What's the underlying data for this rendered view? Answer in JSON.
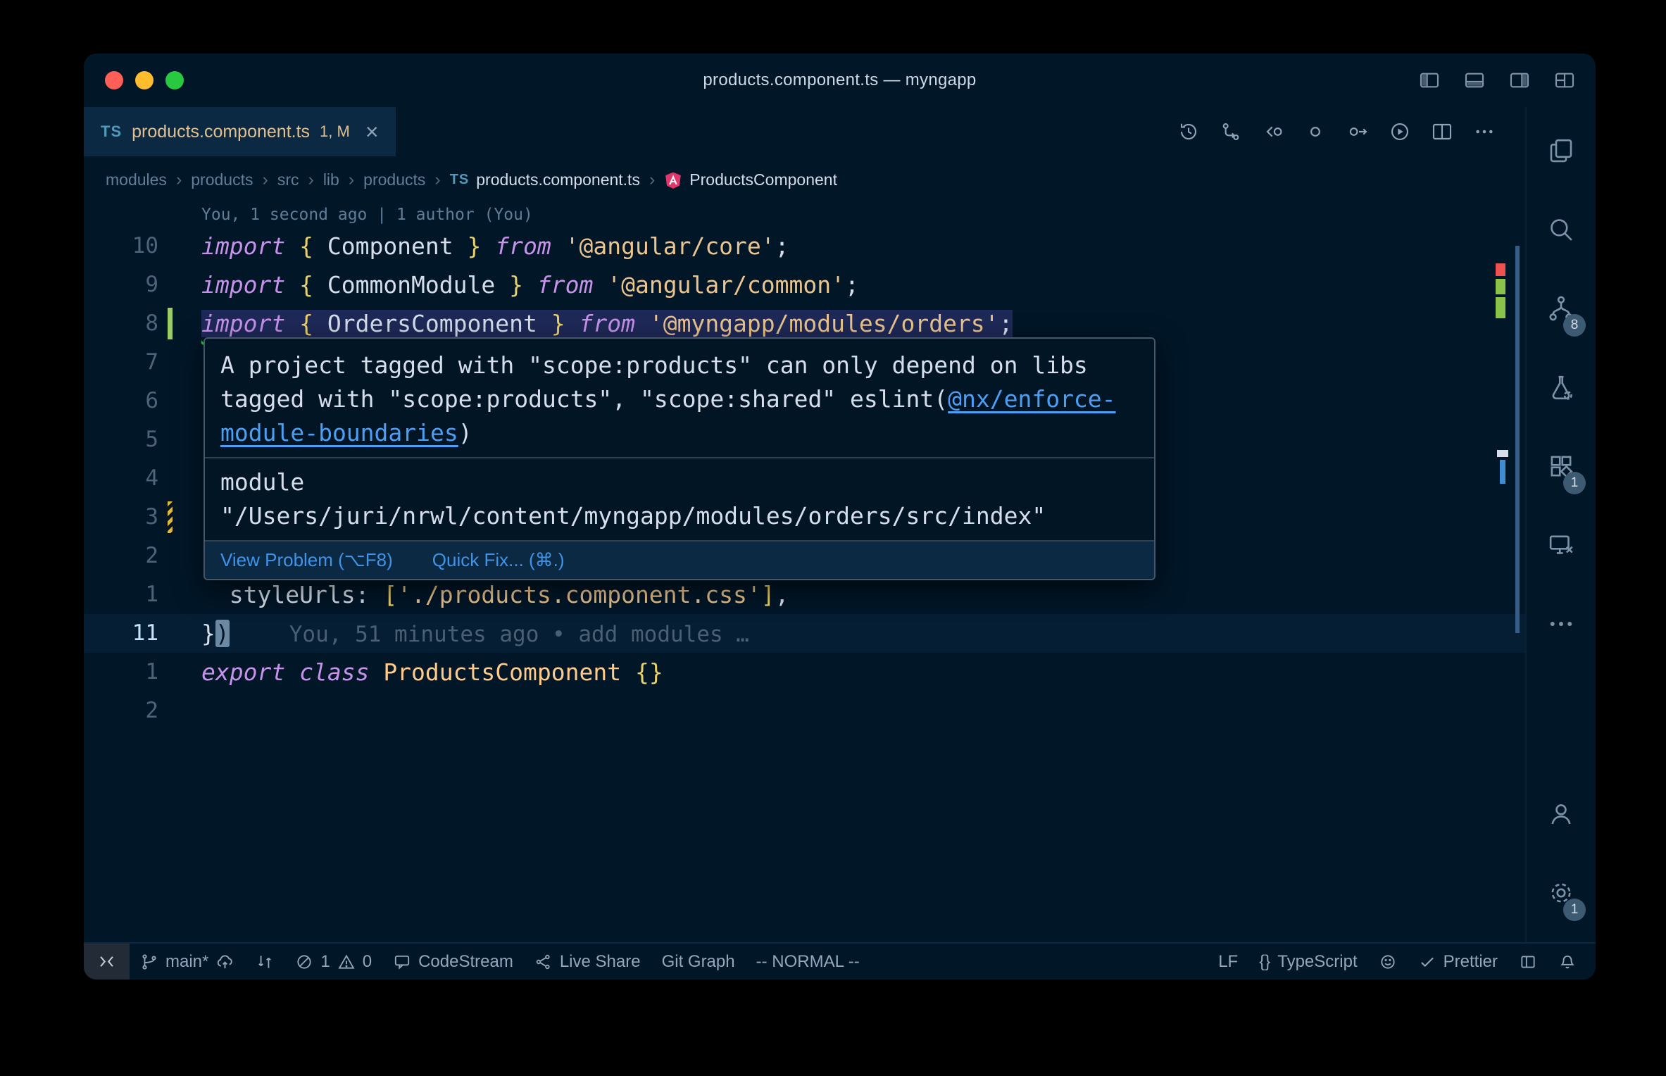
{
  "window": {
    "title": "products.component.ts — myngapp"
  },
  "tab": {
    "filetype": "TS",
    "label": "products.component.ts",
    "decoration": "1, M",
    "close": "×"
  },
  "breadcrumbs": {
    "separator": "›",
    "file_icon": "TS",
    "items": [
      "modules",
      "products",
      "src",
      "lib",
      "products",
      "products.component.ts",
      "ProductsComponent"
    ]
  },
  "codelens": "You, 1 second ago | 1 author (You)",
  "editor": {
    "lines": [
      {
        "num": "10",
        "tokens": [
          [
            "kw",
            "import"
          ],
          [
            "pln",
            " "
          ],
          [
            "brace",
            "{"
          ],
          [
            "pln",
            " "
          ],
          [
            "id",
            "Component"
          ],
          [
            "pln",
            " "
          ],
          [
            "brace",
            "}"
          ],
          [
            "pln",
            " "
          ],
          [
            "kw",
            "from"
          ],
          [
            "pln",
            " "
          ],
          [
            "str",
            "'@angular/core'"
          ],
          [
            "pln",
            ";"
          ]
        ]
      },
      {
        "num": "9",
        "tokens": [
          [
            "kw",
            "import"
          ],
          [
            "pln",
            " "
          ],
          [
            "brace",
            "{"
          ],
          [
            "pln",
            " "
          ],
          [
            "id",
            "CommonModule"
          ],
          [
            "pln",
            " "
          ],
          [
            "brace",
            "}"
          ],
          [
            "pln",
            " "
          ],
          [
            "kw",
            "from"
          ],
          [
            "pln",
            " "
          ],
          [
            "str",
            "'@angular/common'"
          ],
          [
            "pln",
            ";"
          ]
        ]
      },
      {
        "num": "8",
        "marker": "added",
        "highlight": true,
        "squiggle": true,
        "tokens": [
          [
            "kw",
            "import"
          ],
          [
            "pln",
            " "
          ],
          [
            "brace",
            "{"
          ],
          [
            "pln",
            " "
          ],
          [
            "id",
            "OrdersComponent"
          ],
          [
            "pln",
            " "
          ],
          [
            "brace",
            "}"
          ],
          [
            "pln",
            " "
          ],
          [
            "kw",
            "from"
          ],
          [
            "pln",
            " "
          ],
          [
            "str",
            "'@myngapp/modules/orders'"
          ],
          [
            "pln",
            ";"
          ]
        ]
      },
      {
        "num": "7",
        "tokens": []
      },
      {
        "num": "6",
        "tokens": []
      },
      {
        "num": "5",
        "tokens": []
      },
      {
        "num": "4",
        "tokens": []
      },
      {
        "num": "3",
        "marker": "modified",
        "tokens": []
      },
      {
        "num": "2",
        "tokens": []
      },
      {
        "num": "1",
        "tokens": [
          [
            "pln",
            "  "
          ],
          [
            "id",
            "styleUrls"
          ],
          [
            "pln",
            ": "
          ],
          [
            "brace",
            "["
          ],
          [
            "str",
            "'./products.component.css'"
          ],
          [
            "brace",
            "]"
          ],
          [
            "pln",
            ","
          ]
        ]
      },
      {
        "num": "11",
        "current": true,
        "blame": "You, 51 minutes ago • add modules …",
        "tokens": [
          [
            "pln",
            "}"
          ],
          [
            "cursor",
            ")"
          ]
        ]
      },
      {
        "num": "1",
        "tokens": [
          [
            "kw",
            "export"
          ],
          [
            "pln",
            " "
          ],
          [
            "kw",
            "class"
          ],
          [
            "pln",
            " "
          ],
          [
            "cls",
            "ProductsComponent"
          ],
          [
            "pln",
            " "
          ],
          [
            "brace",
            "{}"
          ]
        ]
      },
      {
        "num": "2",
        "tokens": []
      }
    ]
  },
  "hover": {
    "lines": [
      [
        [
          "msg",
          "A project tagged with \"scope:products\" can only depend on libs"
        ]
      ],
      [
        [
          "msg",
          "tagged with \"scope:products\", \"scope:shared\" eslint("
        ],
        [
          "link",
          "@nx/enforce-"
        ]
      ],
      [
        [
          "link",
          "module-boundaries"
        ],
        [
          "msg",
          ")"
        ]
      ]
    ],
    "module_label": "module",
    "module_path": "\"/Users/juri/nrwl/content/myngapp/modules/orders/src/index\"",
    "view_problem": "View Problem (⌥F8)",
    "quick_fix": "Quick Fix... (⌘.)"
  },
  "activitybar": {
    "scm_badge": "8",
    "ext_badge": "1",
    "settings_badge": "1"
  },
  "statusbar": {
    "branch": "main*",
    "errors": "1",
    "warnings": "0",
    "codestream": "CodeStream",
    "live_share": "Live Share",
    "git_graph": "Git Graph",
    "vim_mode": "-- NORMAL --",
    "eol": "LF",
    "lang_icon": "{}",
    "language": "TypeScript",
    "prettier": "Prettier"
  },
  "colors": {
    "editor_bg": "#011627",
    "active_tab_bg": "#0b2942",
    "keyword": "#c792ea",
    "string": "#ecc48d",
    "class_name": "#ffcb8b",
    "modified_gold": "#e2c08d",
    "link_blue": "#4ba0f5",
    "squiggle_green": "#2ec84e",
    "gutter_added_green": "#9ccc65"
  }
}
